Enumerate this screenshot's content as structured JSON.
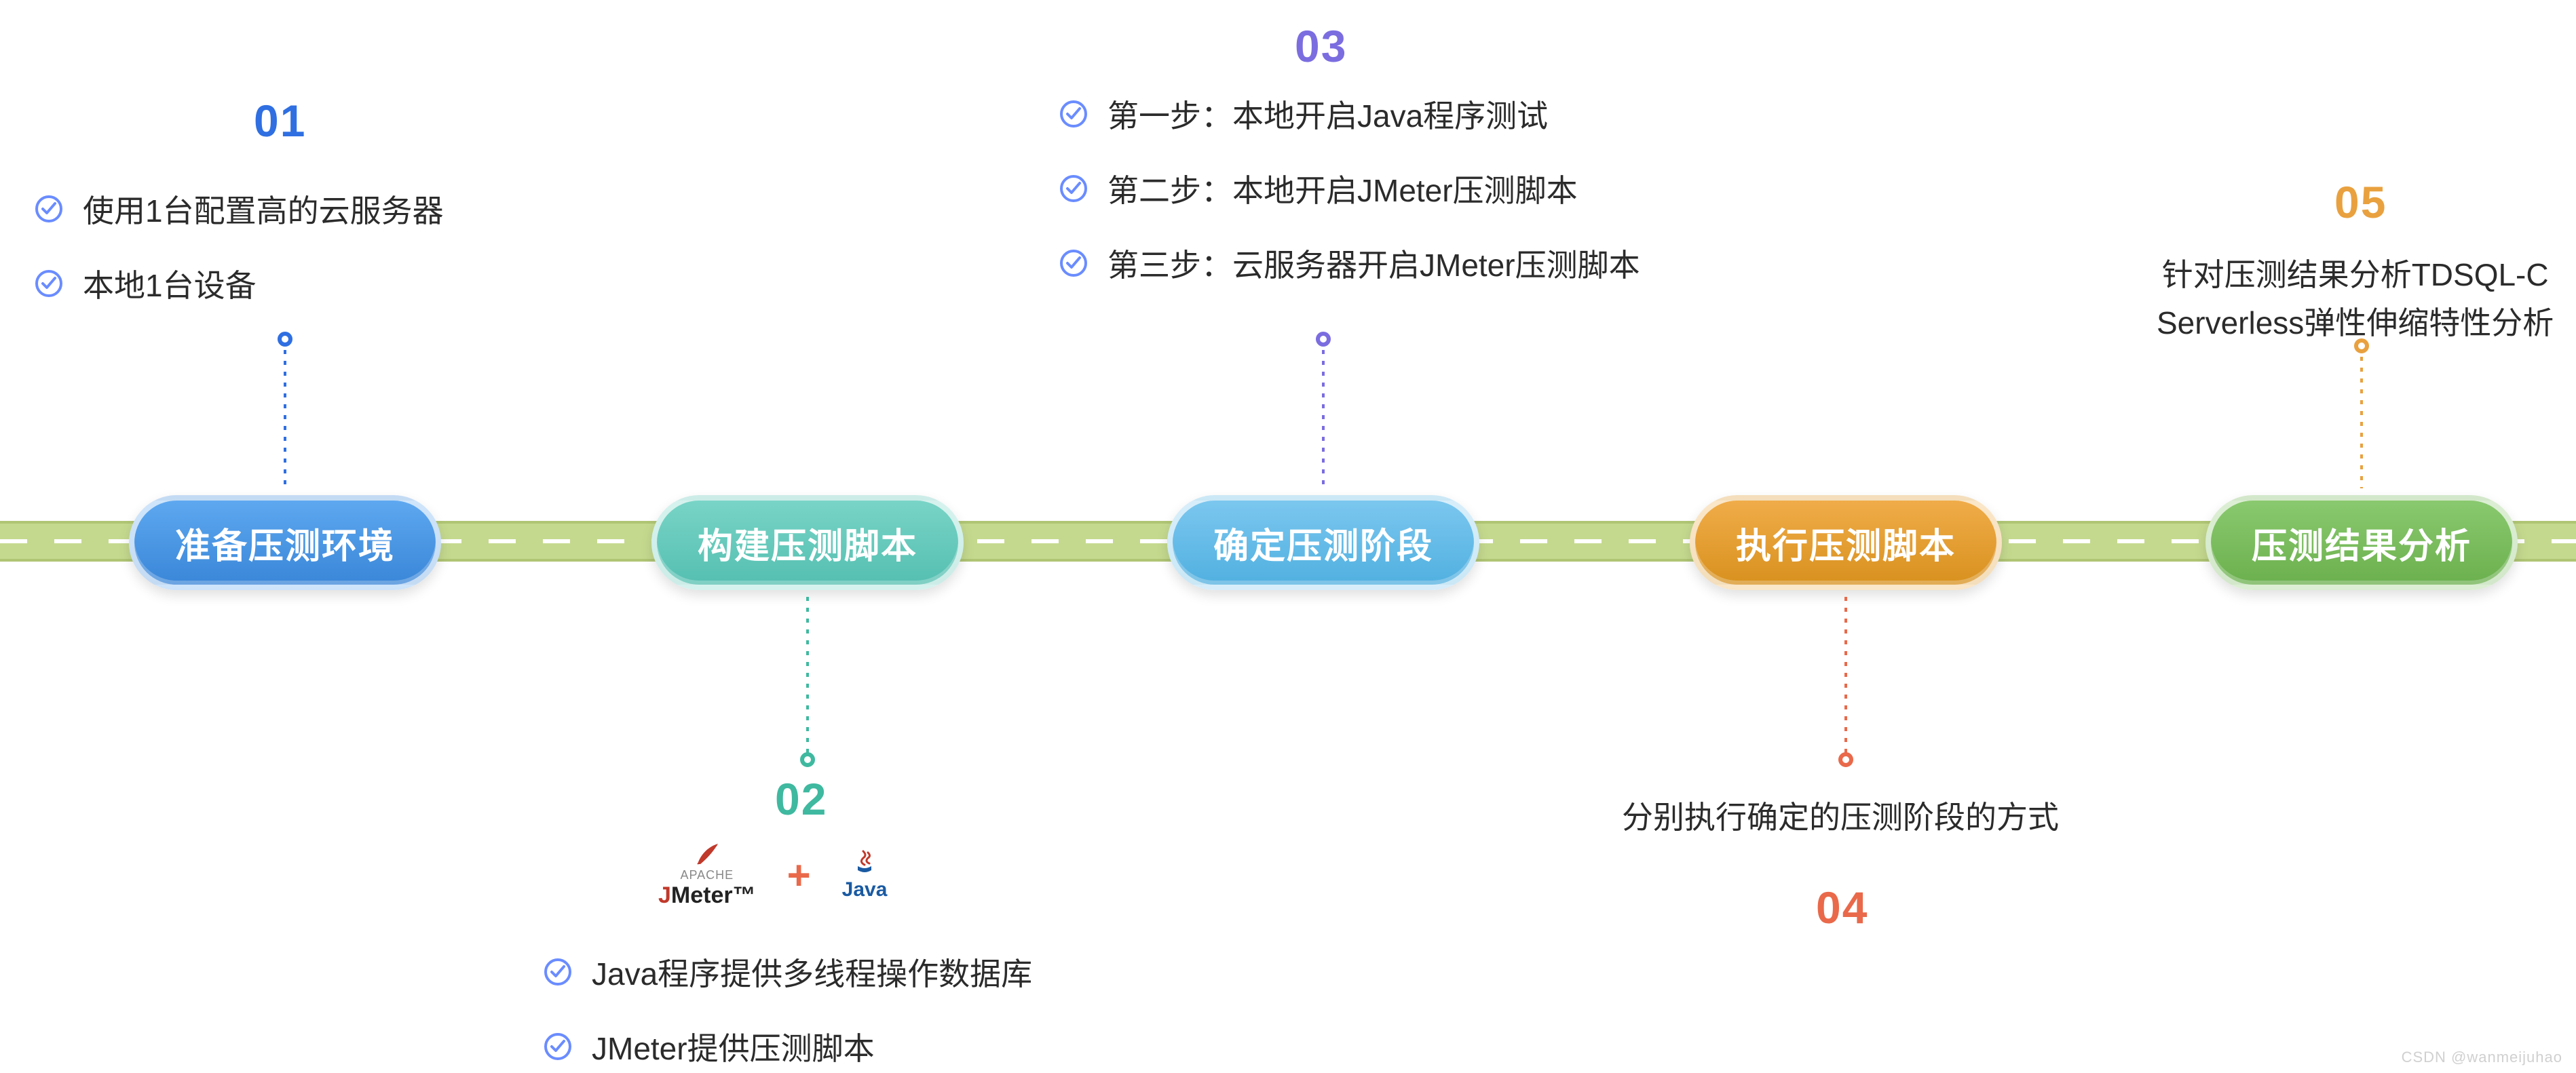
{
  "steps": [
    {
      "num": "01",
      "label": "准备压测环境",
      "num_color": "#2f6fe2"
    },
    {
      "num": "02",
      "label": "构建压测脚本",
      "num_color": "#3fb9a0"
    },
    {
      "num": "03",
      "label": "确定压测阶段",
      "num_color": "#7b6de0"
    },
    {
      "num": "04",
      "label": "执行压测脚本",
      "num_color": "#e9694a"
    },
    {
      "num": "05",
      "label": "压测结果分析",
      "num_color": "#e9a13f"
    }
  ],
  "step1_bullets": [
    "使用1台配置高的云服务器",
    "本地1台设备"
  ],
  "step2_tools": {
    "jmeter_brand_prefix": "APACHE",
    "jmeter_name_black": "JMeter",
    "plus": "+",
    "java_name": "Java"
  },
  "step2_bullets": [
    "Java程序提供多线程操作数据库",
    "JMeter提供压测脚本"
  ],
  "step3_bullets": [
    "第一步：本地开启Java程序测试",
    "第二步：本地开启JMeter压测脚本",
    "第三步：云服务器开启JMeter压测脚本"
  ],
  "step4_text": "分别执行确定的压测阶段的方式",
  "step5_text_line1": "针对压测结果分析TDSQL-C",
  "step5_text_line2": "Serverless弹性伸缩特性分析",
  "watermark": "CSDN @wanmeijuhao"
}
